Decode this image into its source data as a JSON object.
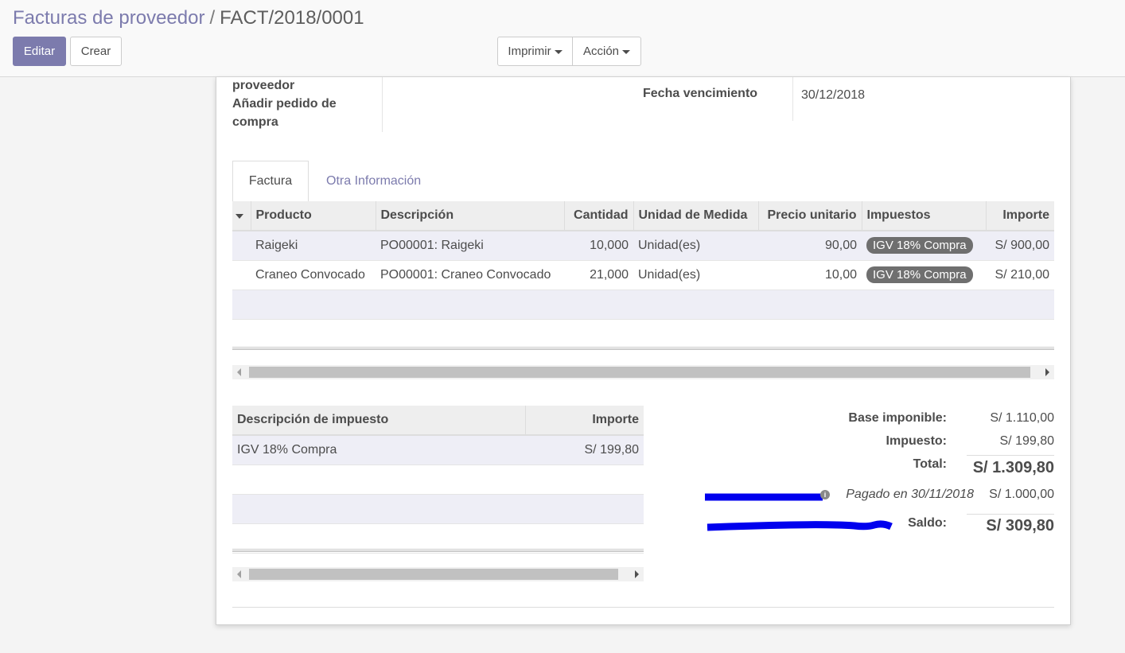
{
  "breadcrumb": {
    "parent": "Facturas de proveedor",
    "separator": "/",
    "current": "FACT/2018/0001"
  },
  "buttons": {
    "edit": "Editar",
    "create": "Crear",
    "print": "Imprimir",
    "action": "Acción"
  },
  "form": {
    "left_label_line1": "proveedor",
    "left_label_line2": "Añadir pedido de",
    "left_label_line3": "compra",
    "due_date_label": "Fecha vencimiento",
    "due_date_value": "30/12/2018"
  },
  "tabs": {
    "invoice": "Factura",
    "other_info": "Otra Información"
  },
  "invoice_lines": {
    "columns": [
      "Producto",
      "Descripción",
      "Cantidad",
      "Unidad de Medida",
      "Precio unitario",
      "Impuestos",
      "Importe"
    ],
    "rows": [
      {
        "product": "Raigeki",
        "description": "PO00001: Raigeki",
        "quantity": "10,000",
        "uom": "Unidad(es)",
        "price": "90,00",
        "tax": "IGV 18% Compra",
        "amount": "S/ 900,00"
      },
      {
        "product": "Craneo Convocado",
        "description": "PO00001: Craneo Convocado",
        "quantity": "21,000",
        "uom": "Unidad(es)",
        "price": "10,00",
        "tax": "IGV 18% Compra",
        "amount": "S/ 210,00"
      }
    ]
  },
  "tax_table": {
    "columns": [
      "Descripción de impuesto",
      "Importe"
    ],
    "rows": [
      {
        "description": "IGV 18% Compra",
        "amount": "S/ 199,80"
      }
    ]
  },
  "totals": {
    "base_label": "Base imponible:",
    "base_value": "S/ 1.110,00",
    "tax_label": "Impuesto:",
    "tax_value": "S/ 199,80",
    "total_label": "Total:",
    "total_value": "S/ 1.309,80",
    "payment_label": "Pagado en 30/11/2018",
    "payment_value": "S/ 1.000,00",
    "balance_label": "Saldo:",
    "balance_value": "S/ 309,80"
  },
  "colors": {
    "brand": "#7c7bad",
    "tag": "#6f6f6f",
    "annotation": "#0000ee"
  }
}
